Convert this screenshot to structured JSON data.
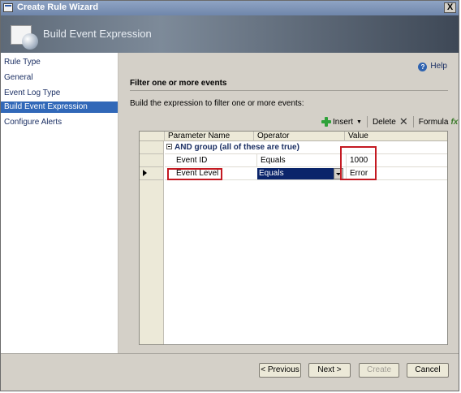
{
  "window": {
    "title": "Create Rule Wizard",
    "close_glyph": "X"
  },
  "banner": {
    "title": "Build Event Expression"
  },
  "nav": {
    "items": [
      {
        "label": "Rule Type"
      },
      {
        "label": "General"
      },
      {
        "label": "Event Log Type"
      },
      {
        "label": "Build Event Expression"
      },
      {
        "label": "Configure Alerts"
      }
    ],
    "selected": "Build Event Expression"
  },
  "content": {
    "help_label": "Help",
    "section_title": "Filter one or more events",
    "instructions": "Build the expression to filter one or more events:"
  },
  "toolbar": {
    "insert_label": "Insert",
    "delete_label": "Delete",
    "formula_label": "Formula"
  },
  "grid": {
    "columns": [
      "Parameter Name",
      "Operator",
      "Value"
    ],
    "group_label": "AND group (all of these are true)",
    "rows": [
      {
        "parameter": "Event ID",
        "operator": "Equals",
        "value": "1000"
      },
      {
        "parameter": "Event Level",
        "operator": "Equals",
        "value": "Error"
      }
    ]
  },
  "footer": {
    "previous_label": "< Previous",
    "next_label": "Next >",
    "create_label": "Create",
    "cancel_label": "Cancel"
  },
  "colors": {
    "nav_selected": "#3168b8",
    "highlight_box": "#c41a22",
    "selected_cell": "#0a246a"
  }
}
